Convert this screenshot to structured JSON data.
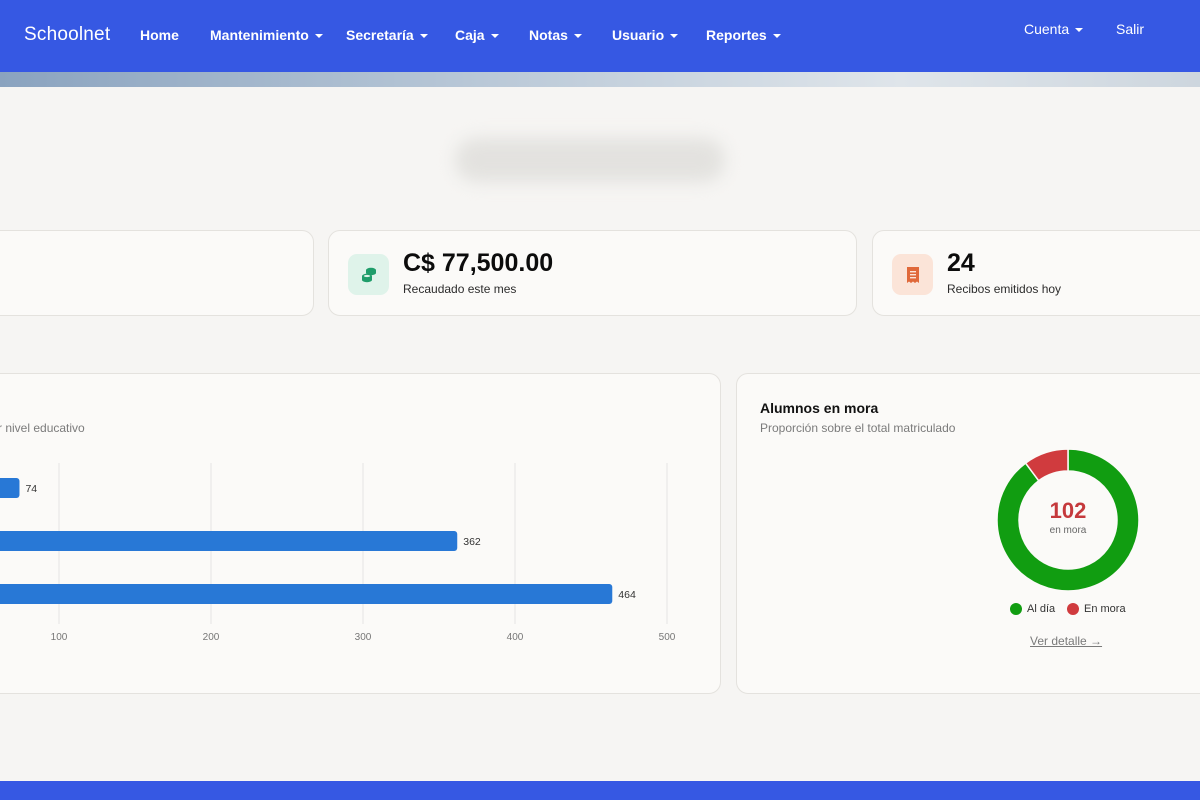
{
  "navbar": {
    "brand": "Schoolnet",
    "items": [
      {
        "label": "Home",
        "dropdown": false
      },
      {
        "label": "Mantenimiento",
        "dropdown": true
      },
      {
        "label": "Secretaría",
        "dropdown": true
      },
      {
        "label": "Caja",
        "dropdown": true
      },
      {
        "label": "Notas",
        "dropdown": true
      },
      {
        "label": "Usuario",
        "dropdown": true
      },
      {
        "label": "Reportes",
        "dropdown": true
      }
    ],
    "account": {
      "label": "Cuenta",
      "dropdown": true
    },
    "logout": "Salir",
    "color": "#3658e3"
  },
  "stats": [
    {
      "value": "C$ 77,500.00",
      "label": "Recaudado este mes",
      "icon": "coins-icon",
      "icon_color": "#1f9d6a",
      "icon_bg": "#dff3ea"
    },
    {
      "value": "24",
      "label": "Recibos emitidos hoy",
      "icon": "receipt-icon",
      "icon_color": "#e0693a",
      "icon_bg": "#fbe4d8"
    }
  ],
  "students_chart": {
    "subtitle": "r nivel educativo",
    "chart_data": {
      "type": "bar",
      "orientation": "horizontal",
      "categories": [
        "",
        "",
        ""
      ],
      "values": [
        74,
        362,
        464
      ],
      "data_labels": [
        "74",
        "362",
        "464"
      ],
      "xticks": [
        "100",
        "200",
        "300",
        "400",
        "500"
      ],
      "xlim": [
        0,
        500
      ],
      "grid": true,
      "bar_color": "#2878d6"
    }
  },
  "mora_chart": {
    "title": "Alumnos en mora",
    "subtitle": "Proporción sobre el total matriculado",
    "center_value": "102",
    "center_label": "en mora",
    "legend": [
      {
        "label": "Al día",
        "color": "#119d11"
      },
      {
        "label": "En mora",
        "color": "#d03b3e"
      }
    ],
    "link": "Ver detalle →",
    "chart_data": {
      "type": "pie",
      "style": "donut",
      "labels": [
        "Al día",
        "En mora"
      ],
      "values": [
        898,
        102
      ],
      "colors": [
        "#119d11",
        "#d03b3e"
      ]
    }
  }
}
